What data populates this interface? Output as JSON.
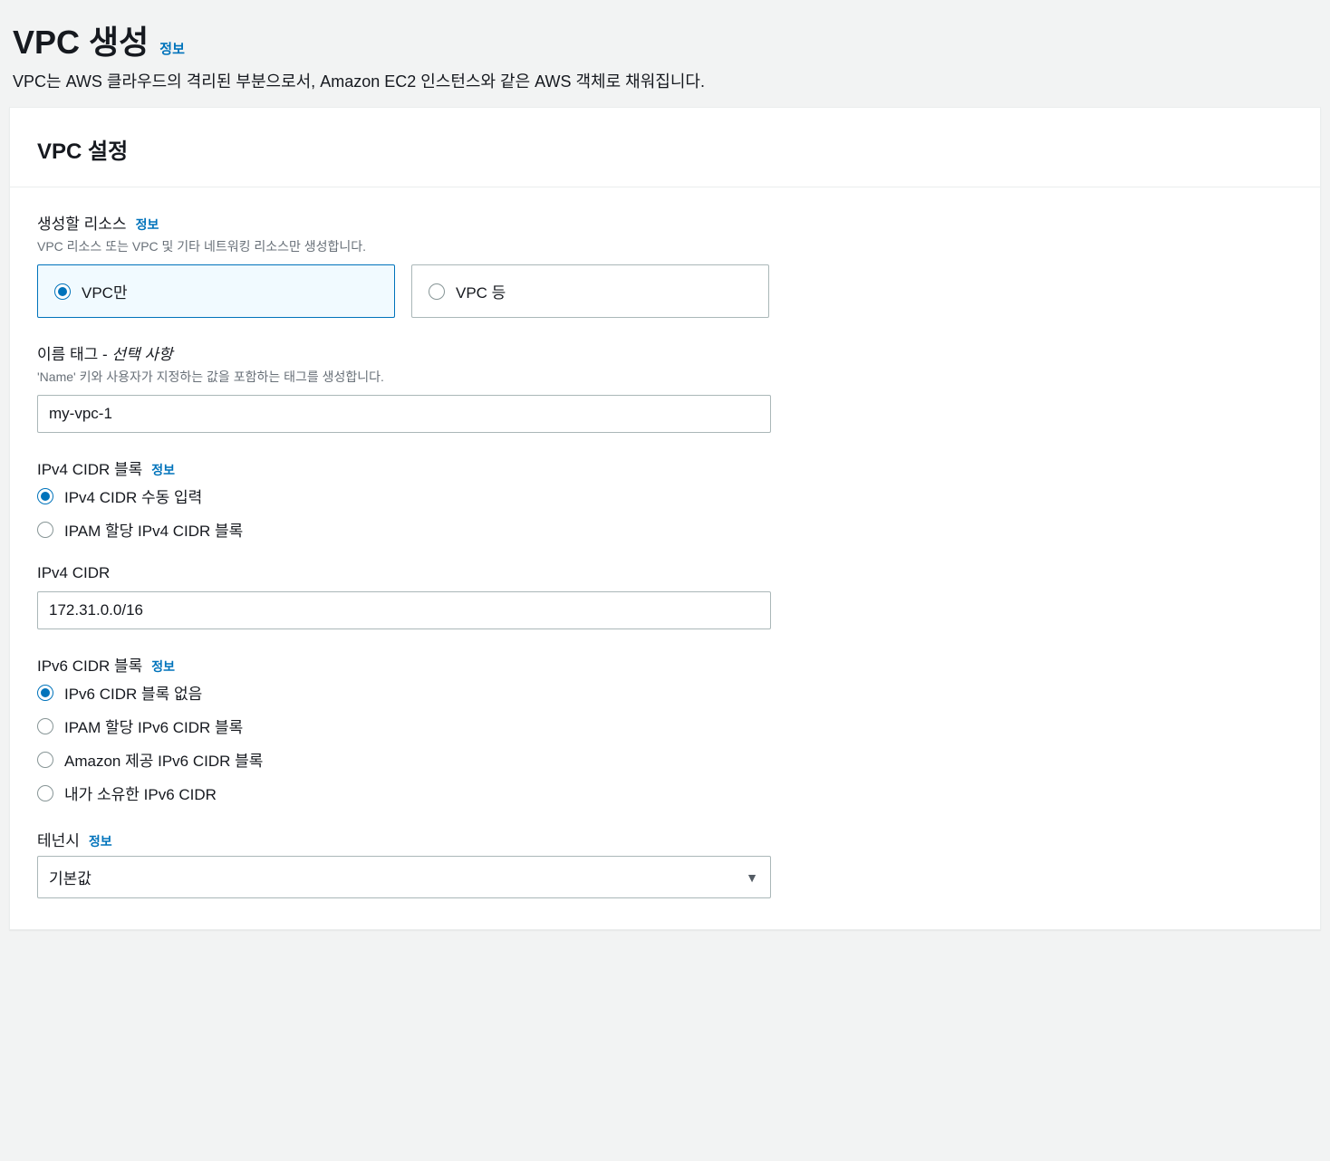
{
  "header": {
    "title": "VPC 생성",
    "info": "정보",
    "desc": "VPC는 AWS 클라우드의 격리된 부분으로서, Amazon EC2 인스턴스와 같은 AWS 객체로 채워집니다."
  },
  "panel": {
    "title": "VPC 설정"
  },
  "resources": {
    "label": "생성할 리소스",
    "info": "정보",
    "desc": "VPC 리소스 또는 VPC 및 기타 네트워킹 리소스만 생성합니다.",
    "options": {
      "only": "VPC만",
      "etc": "VPC 등"
    }
  },
  "nameTag": {
    "label_prefix": "이름 태그 - ",
    "label_optional": "선택 사항",
    "desc": "'Name' 키와 사용자가 지정하는 값을 포함하는 태그를 생성합니다.",
    "value": "my-vpc-1"
  },
  "ipv4Block": {
    "label": "IPv4 CIDR 블록",
    "info": "정보",
    "options": {
      "manual": "IPv4 CIDR 수동 입력",
      "ipam": "IPAM 할당 IPv4 CIDR 블록"
    }
  },
  "ipv4Cidr": {
    "label": "IPv4 CIDR",
    "value": "172.31.0.0/16"
  },
  "ipv6Block": {
    "label": "IPv6 CIDR 블록",
    "info": "정보",
    "options": {
      "none": "IPv6 CIDR 블록 없음",
      "ipam": "IPAM 할당 IPv6 CIDR 블록",
      "aws": "Amazon 제공 IPv6 CIDR 블록",
      "own": "내가 소유한 IPv6 CIDR"
    }
  },
  "tenancy": {
    "label": "테넌시",
    "info": "정보",
    "value": "기본값"
  }
}
